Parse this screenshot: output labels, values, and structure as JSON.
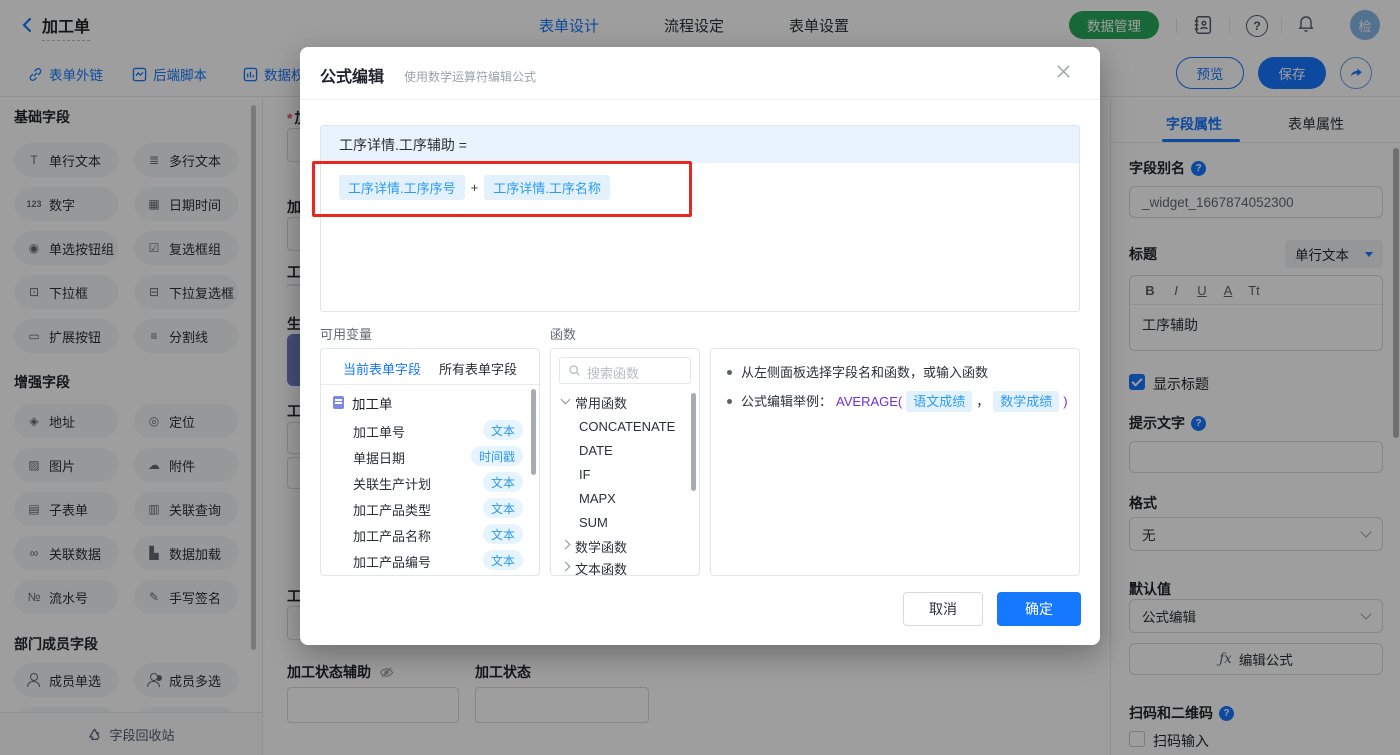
{
  "colors": {
    "primary": "#1677ff",
    "green": "#29a95c",
    "token_text": "#2b9cf0",
    "token_bg": "#e3f1fd",
    "annotation_red": "#e8281e",
    "fn_purple": "#722ed1"
  },
  "icons": {
    "question_mark": "?",
    "fx": "ƒx"
  },
  "top_bar": {
    "back_title": "加工单",
    "tabs": [
      {
        "label": "表单设计",
        "active": true
      },
      {
        "label": "流程设定",
        "active": false
      },
      {
        "label": "表单设置",
        "active": false
      }
    ],
    "data_manage_label": "数据管理",
    "avatar_text": "检"
  },
  "toolbar": {
    "links": [
      {
        "label": "表单外链"
      },
      {
        "label": "后端脚本"
      },
      {
        "label": "数据权"
      }
    ],
    "preview_label": "预览",
    "save_label": "保存"
  },
  "sidebar": {
    "sections": [
      {
        "title": "基础字段",
        "items": [
          {
            "label": "单行文本",
            "glyph": "T"
          },
          {
            "label": "多行文本",
            "glyph": "≣"
          },
          {
            "label": "数字",
            "glyph": "123"
          },
          {
            "label": "日期时间",
            "glyph": "▦"
          },
          {
            "label": "单选按钮组",
            "glyph": "◉"
          },
          {
            "label": "复选框组",
            "glyph": "☑"
          },
          {
            "label": "下拉框",
            "glyph": "⊡"
          },
          {
            "label": "下拉复选框",
            "glyph": "⊟"
          },
          {
            "label": "扩展按钮",
            "glyph": "▭"
          },
          {
            "label": "分割线",
            "glyph": "≡"
          }
        ]
      },
      {
        "title": "增强字段",
        "items": [
          {
            "label": "地址",
            "glyph": "◈"
          },
          {
            "label": "定位",
            "glyph": "◎"
          },
          {
            "label": "图片",
            "glyph": "▨"
          },
          {
            "label": "附件",
            "glyph": "☁"
          },
          {
            "label": "子表单",
            "glyph": "▤"
          },
          {
            "label": "关联查询",
            "glyph": "▥"
          },
          {
            "label": "关联数据",
            "glyph": "∞"
          },
          {
            "label": "数据加载",
            "glyph": "▙"
          },
          {
            "label": "流水号",
            "glyph": "№"
          },
          {
            "label": "手写签名",
            "glyph": "✎"
          }
        ]
      },
      {
        "title": "部门成员字段",
        "items": [
          {
            "label": "成员单选"
          },
          {
            "label": "成员多选"
          }
        ]
      }
    ],
    "recycle_label": "字段回收站"
  },
  "canvas": {
    "required_mark": "*",
    "partial_labels": [
      "加",
      "加",
      "工",
      "生",
      "工",
      "工"
    ],
    "bottom_fields": [
      {
        "label": "加工状态辅助"
      },
      {
        "label": "加工状态"
      }
    ]
  },
  "modal": {
    "title": "公式编辑",
    "subtitle": "使用数学运算符编辑公式",
    "formula_target": "工序详情.工序辅助 =",
    "tokens": [
      "工序详情.工序序号",
      "工序详情.工序名称"
    ],
    "operator": "+",
    "variables": {
      "label": "可用变量",
      "tabs": [
        {
          "label": "当前表单字段",
          "active": true
        },
        {
          "label": "所有表单字段",
          "active": false
        }
      ],
      "form_name": "加工单",
      "fields": [
        {
          "name": "加工单号",
          "type": "文本"
        },
        {
          "name": "单据日期",
          "type": "时间戳"
        },
        {
          "name": "关联生产计划",
          "type": "文本"
        },
        {
          "name": "加工产品类型",
          "type": "文本"
        },
        {
          "name": "加工产品名称",
          "type": "文本"
        },
        {
          "name": "加工产品编号",
          "type": "文本"
        }
      ]
    },
    "functions": {
      "label": "函数",
      "search_placeholder": "搜索函数",
      "groups": [
        {
          "label": "常用函数",
          "expanded": true,
          "items": [
            "CONCATENATE",
            "DATE",
            "IF",
            "MAPX",
            "SUM"
          ]
        },
        {
          "label": "数学函数",
          "expanded": false
        },
        {
          "label": "文本函数",
          "expanded": false
        }
      ]
    },
    "tips": {
      "line1": "从左侧面板选择字段名和函数，或输入函数",
      "line2_prefix": "公式编辑举例：",
      "fn_call": "AVERAGE(",
      "token1": "语文成绩",
      "separator": "，",
      "token2": "数学成绩",
      "close_paren": ")"
    },
    "cancel_label": "取消",
    "confirm_label": "确定"
  },
  "right_panel": {
    "tabs": [
      {
        "label": "字段属性",
        "active": true
      },
      {
        "label": "表单属性",
        "active": false
      }
    ],
    "alias_label": "字段别名",
    "alias_value": "_widget_1667874052300",
    "title_label": "标题",
    "widget_type": "单行文本",
    "editor_toolbar": [
      "B",
      "I",
      "U",
      "A",
      "Tt"
    ],
    "title_value": "工序辅助",
    "show_title_label": "显示标题",
    "placeholder_label": "提示文字",
    "format_label": "格式",
    "format_value": "无",
    "default_label": "默认值",
    "default_value": "公式编辑",
    "fx_label": "编辑公式",
    "qr_label": "扫码和二维码",
    "scan_label": "扫码输入"
  }
}
